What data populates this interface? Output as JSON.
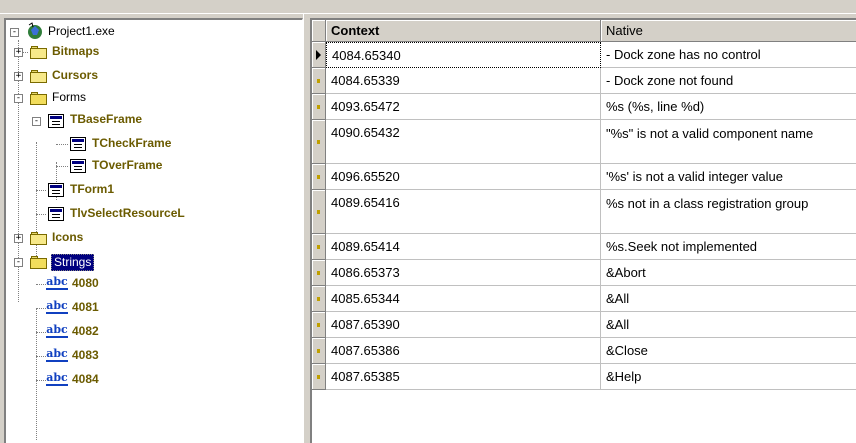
{
  "tree": {
    "root": {
      "label": "Project1.exe",
      "icon": "exe-icon"
    },
    "nodes": [
      {
        "label": "Bitmaps",
        "icon": "folder-icon",
        "expander": "+"
      },
      {
        "label": "Cursors",
        "icon": "folder-icon",
        "expander": "+"
      },
      {
        "label": "Forms",
        "icon": "folder-open-icon",
        "expander": "-"
      },
      {
        "label": "TBaseFrame",
        "icon": "form-icon",
        "expander": "-"
      },
      {
        "label": "TCheckFrame",
        "icon": "frame-icon"
      },
      {
        "label": "TOverFrame",
        "icon": "frame-icon"
      },
      {
        "label": "TForm1",
        "icon": "form-icon"
      },
      {
        "label": "TlvSelectResourceL",
        "icon": "form-icon"
      },
      {
        "label": "Icons",
        "icon": "folder-icon",
        "expander": "+"
      },
      {
        "label": "Strings",
        "icon": "folder-open-icon",
        "expander": "-"
      },
      {
        "label": "4080",
        "icon": "abc-icon"
      },
      {
        "label": "4081",
        "icon": "abc-icon"
      },
      {
        "label": "4082",
        "icon": "abc-icon"
      },
      {
        "label": "4083",
        "icon": "abc-icon"
      },
      {
        "label": "4084",
        "icon": "abc-icon"
      }
    ],
    "abc_text": "abc"
  },
  "grid": {
    "columns": {
      "context": "Context",
      "native": "Native"
    },
    "rows": [
      {
        "context": "4084.65340",
        "native": " - Dock zone has no control"
      },
      {
        "context": "4084.65339",
        "native": " - Dock zone not found"
      },
      {
        "context": "4093.65472",
        "native": "%s (%s, line %d)"
      },
      {
        "context": "4090.65432",
        "native": "\"%s\" is not a valid component name"
      },
      {
        "context": "4096.65520",
        "native": "'%s' is not a valid integer value"
      },
      {
        "context": "4089.65416",
        "native": "%s not in a class registration group"
      },
      {
        "context": "4089.65414",
        "native": "%s.Seek not implemented"
      },
      {
        "context": "4086.65373",
        "native": "&Abort"
      },
      {
        "context": "4085.65344",
        "native": "&All"
      },
      {
        "context": "4087.65390",
        "native": "&All"
      },
      {
        "context": "4087.65386",
        "native": "&Close"
      },
      {
        "context": "4087.65385",
        "native": "&Help"
      }
    ]
  },
  "colors": {
    "selection": "#000080",
    "tree_bold_text": "#6b5b00",
    "panel": "#d4d0c8"
  }
}
